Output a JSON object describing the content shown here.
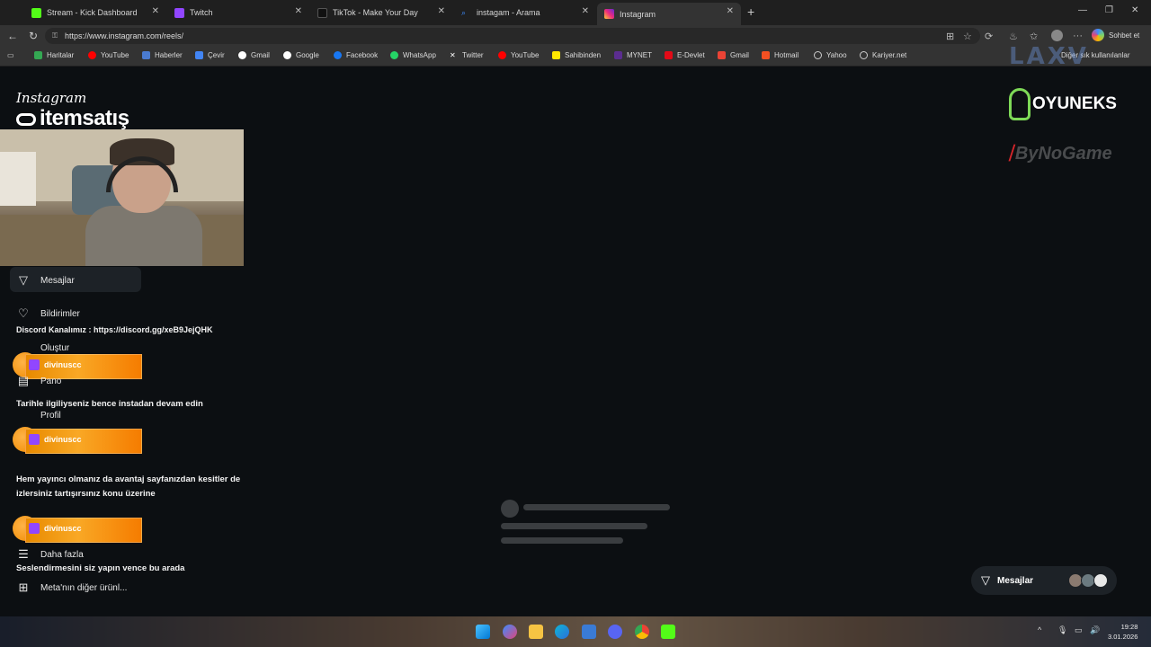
{
  "tabs": [
    {
      "label": "Stream - Kick Dashboard",
      "color": "#53fc18"
    },
    {
      "label": "Twitch",
      "color": "#9146ff"
    },
    {
      "label": "TikTok - Make Your Day",
      "color": "#111111"
    },
    {
      "label": "instagam - Arama",
      "color": "#3c8cff"
    },
    {
      "label": "Instagram",
      "color": "#e1306c"
    }
  ],
  "address": {
    "url": "https://www.instagram.com/reels/"
  },
  "toolbar": {
    "chat_label": "Sohbet et"
  },
  "bookmarks": [
    {
      "label": "Haritalar",
      "color": "#34a853"
    },
    {
      "label": "YouTube",
      "color": "#ff0000"
    },
    {
      "label": "Haberler",
      "color": "#4a7bd0"
    },
    {
      "label": "Çevir",
      "color": "#4285f4"
    },
    {
      "label": "Gmail",
      "color": "#ea4335"
    },
    {
      "label": "Google",
      "color": "#ffffff"
    },
    {
      "label": "Facebook",
      "color": "#1877f2"
    },
    {
      "label": "WhatsApp",
      "color": "#25d366"
    },
    {
      "label": "Twitter",
      "color": "#ffffff"
    },
    {
      "label": "YouTube",
      "color": "#ff0000"
    },
    {
      "label": "Sahibinden",
      "color": "#ffe800"
    },
    {
      "label": "MYNET",
      "color": "#5b2d90"
    },
    {
      "label": "E-Devlet",
      "color": "#e30a17"
    },
    {
      "label": "Gmail",
      "color": "#ea4335"
    },
    {
      "label": "Hotmail",
      "color": "#f25022"
    },
    {
      "label": "Yahoo",
      "color": "#cccccc"
    },
    {
      "label": "Kariyer.net",
      "color": "#cccccc"
    }
  ],
  "bookmarks_other": "Diğer sık kullanılanlar",
  "overlay": {
    "ig_logo": "Instagram",
    "itemsatis": "itemsatış",
    "laxv": "LAXV",
    "oyuneks": "OYUNEKS",
    "bynogame": "ByNoGame",
    "twitch_user": "divinuscc"
  },
  "nav": {
    "messages": "Mesajlar",
    "notifications": "Bildirimler",
    "create": "Oluştur",
    "dashboard": "Pano",
    "profile": "Profil",
    "more": "Daha fazla",
    "meta": "Meta'nın diğer ürünl..."
  },
  "chat": {
    "ghost": "Discord Kanalımız : https://discord.gg/xeB9JejQHK",
    "msg1": "Tarihle ilgiliyseniz bence instadan devam edin",
    "msg2": "Hem yayıncı olmanız da avantaj sayfanızdan kesitler de izlersiniz tartışırsınız konu üzerine",
    "msg3": "Seslendirmesini siz yapın vence bu arada"
  },
  "dm_pill": {
    "label": "Mesajlar"
  },
  "clock": {
    "time": "19:28",
    "date": "3.01.2026"
  }
}
